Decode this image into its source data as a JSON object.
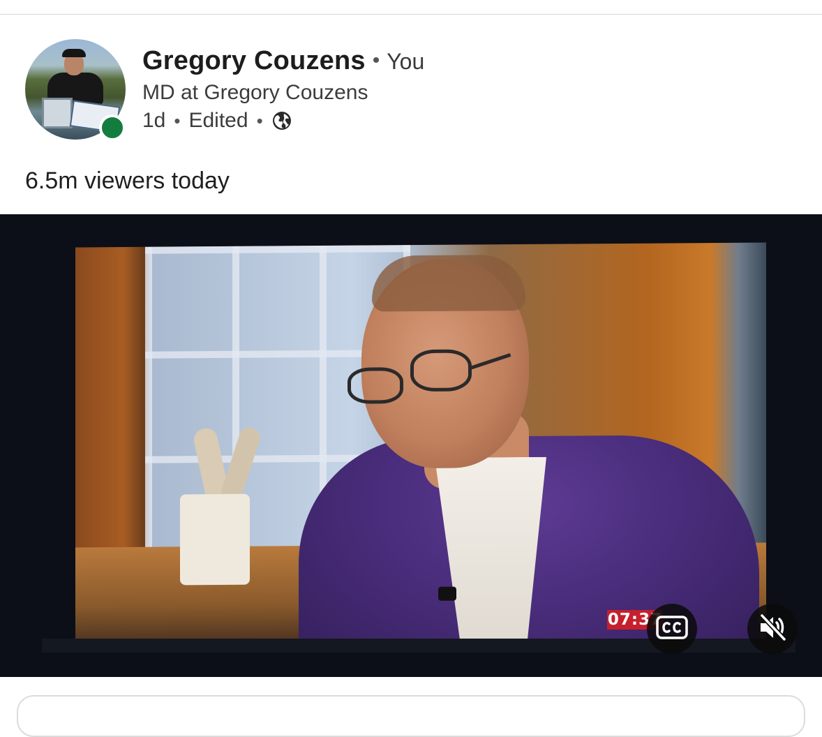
{
  "post": {
    "author": {
      "name": "Gregory Couzens",
      "separator": "•",
      "relation": "You",
      "headline": "MD at Gregory Couzens",
      "online_status_color": "#127d3e"
    },
    "meta": {
      "age": "1d",
      "dot": "•",
      "edited": "Edited",
      "visibility_icon": "globe-icon"
    },
    "text": "6.5m viewers today",
    "video": {
      "broadcast_clock": "07:37",
      "controls": {
        "captions_icon": "cc-icon",
        "mute_icon": "speaker-muted-icon"
      }
    }
  },
  "colors": {
    "accent_green": "#127d3e",
    "broadcast_red": "#c6202d"
  }
}
